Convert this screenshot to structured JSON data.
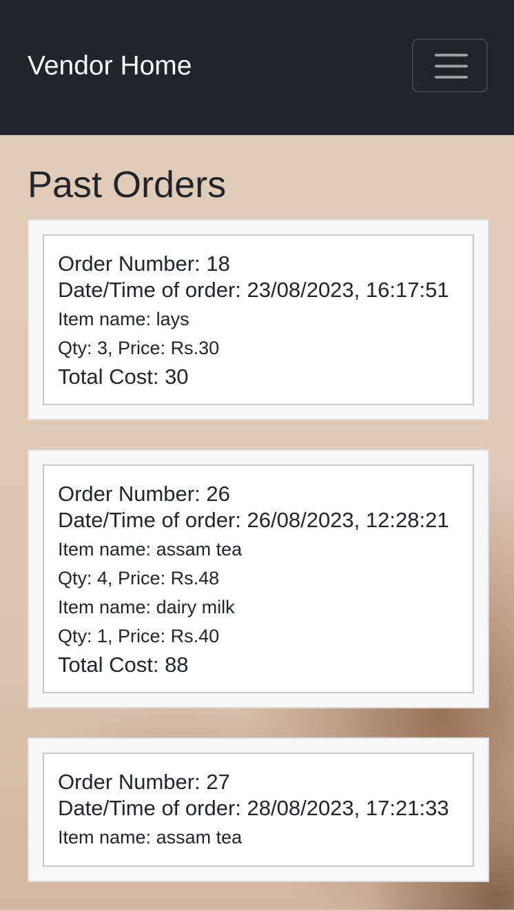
{
  "navbar": {
    "brand": "Vendor Home",
    "toggler_icon": "hamburger-menu-icon"
  },
  "page": {
    "title": "Past Orders"
  },
  "labels": {
    "order_number": "Order Number: ",
    "datetime": "Date/Time of order: ",
    "item_name": "Item name: ",
    "qty": "Qty: ",
    "price": ", Price: Rs.",
    "total": "Total Cost: "
  },
  "orders": [
    {
      "number": "18",
      "datetime": "23/08/2023, 16:17:51",
      "items": [
        {
          "name": "lays",
          "qty": "3",
          "price": "30"
        }
      ],
      "total": "30"
    },
    {
      "number": "26",
      "datetime": "26/08/2023, 12:28:21",
      "items": [
        {
          "name": "assam tea",
          "qty": "4",
          "price": "48"
        },
        {
          "name": "dairy milk",
          "qty": "1",
          "price": "40"
        }
      ],
      "total": "88"
    },
    {
      "number": "27",
      "datetime": "28/08/2023, 17:21:33",
      "items": [
        {
          "name": "assam tea",
          "qty": "",
          "price": ""
        }
      ],
      "total": ""
    }
  ],
  "colors": {
    "navbar_bg": "#212529",
    "card_bg": "#f8f8f8",
    "inner_bg": "#ffffff"
  }
}
